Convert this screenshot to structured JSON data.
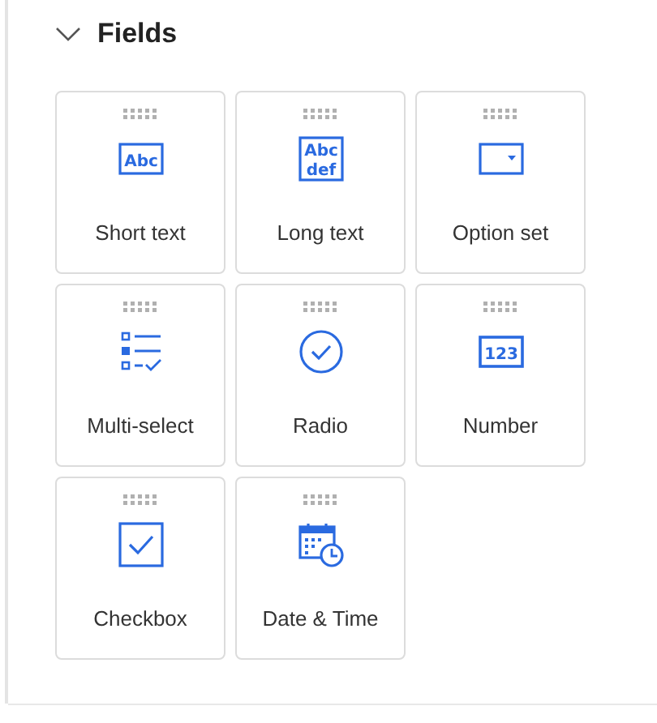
{
  "section": {
    "title": "Fields",
    "expanded": true
  },
  "fields": [
    {
      "label": "Short text",
      "kind": "short-text",
      "glyph": [
        "Abc"
      ]
    },
    {
      "label": "Long text",
      "kind": "long-text",
      "glyph": [
        "Abc",
        "def"
      ]
    },
    {
      "label": "Option set",
      "kind": "option-set"
    },
    {
      "label": "Multi-select",
      "kind": "multi-select"
    },
    {
      "label": "Radio",
      "kind": "radio"
    },
    {
      "label": "Number",
      "kind": "number",
      "glyph": [
        "123"
      ]
    },
    {
      "label": "Checkbox",
      "kind": "checkbox"
    },
    {
      "label": "Date & Time",
      "kind": "datetime"
    }
  ]
}
